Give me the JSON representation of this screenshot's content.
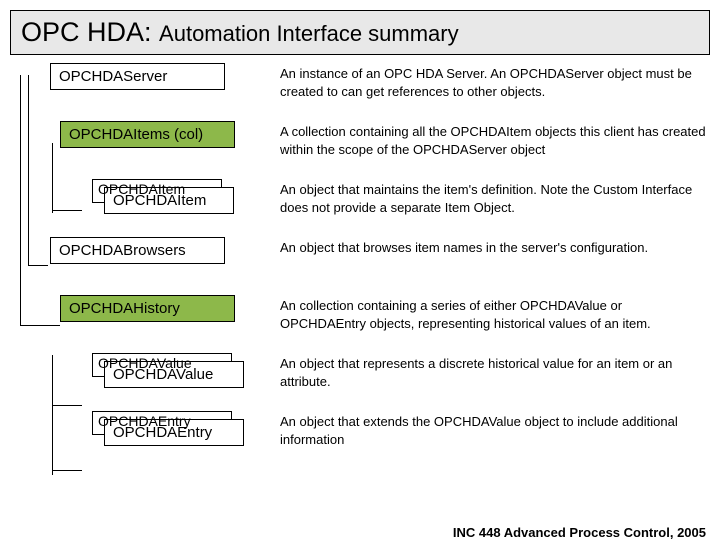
{
  "title": {
    "main": "OPC HDA:",
    "sub": "Automation Interface summary"
  },
  "rows": [
    {
      "label": "OPCHDAServer",
      "desc": "An instance of an OPC HDA Server. An OPCHDAServer object must be created to can get references to other objects."
    },
    {
      "label": "OPCHDAItems (col)",
      "desc": "A collection containing all the OPCHDAItem objects this client has created within the scope of the OPCHDAServer object"
    },
    {
      "label_back": "OPCHDAItem",
      "label": "OPCHDAItem",
      "desc": "An object that maintains the item's definition. Note the Custom Interface does not provide a separate Item Object."
    },
    {
      "label": "OPCHDABrowsers",
      "desc": "An object that browses item names in the server's configuration."
    },
    {
      "label": "OPCHDAHistory",
      "desc": "An collection containing a series of either OPCHDAValue or OPCHDAEntry objects, representing historical values of an item."
    },
    {
      "label_back": "OPCHDAValue",
      "label": "OPCHDAValue",
      "desc": "An object that represents a discrete historical value for an item or an attribute."
    },
    {
      "label_back": "OPCHDAEntry",
      "label": "OPCHDAEntry",
      "desc": "An object that extends the OPCHDAValue object to include additional information"
    }
  ],
  "footer": "INC 448 Advanced Process Control, 2005"
}
